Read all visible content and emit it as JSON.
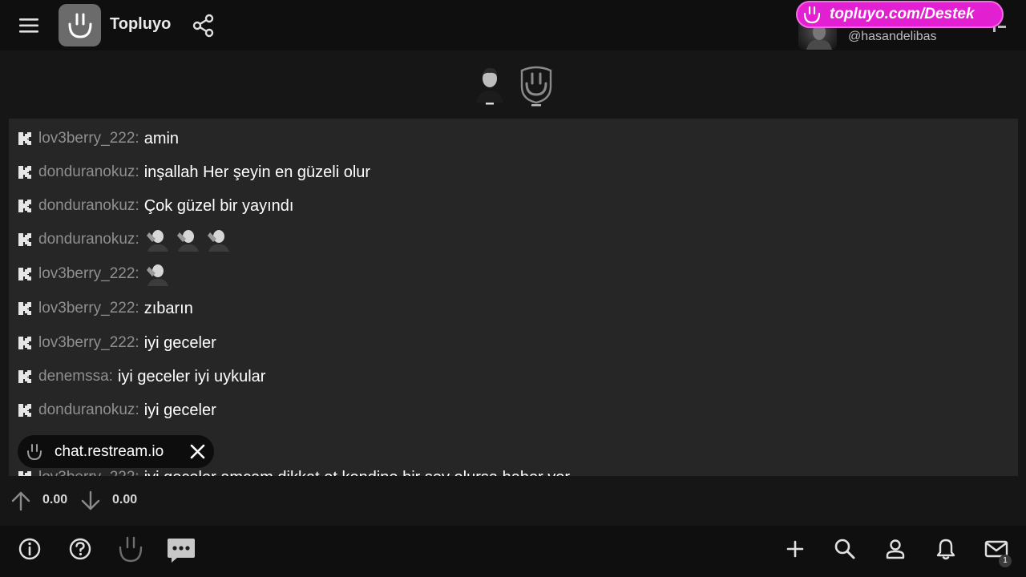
{
  "header": {
    "title": "Topluyo",
    "user_handle": "@hasandelibas"
  },
  "promo": {
    "text": "topluyo.com/Destek",
    "color": "#e21fd1"
  },
  "chat": {
    "messages": [
      {
        "user": "lov3berry_222",
        "text": "amin"
      },
      {
        "user": "donduranokuz",
        "text": "inşallah Her şeyin en güzeli olur"
      },
      {
        "user": "donduranokuz",
        "text": "Çok güzel bir yayındı"
      },
      {
        "user": "donduranokuz",
        "text": "",
        "emotes": 3
      },
      {
        "user": "lov3berry_222",
        "text": "",
        "emotes": 1
      },
      {
        "user": "lov3berry_222",
        "text": "zıbarın"
      },
      {
        "user": "lov3berry_222",
        "text": "iyi geceler"
      },
      {
        "user": "denemssa",
        "text": "iyi geceler iyi uykular"
      },
      {
        "user": "donduranokuz",
        "text": "iyi geceler"
      },
      {
        "user": "lov3berry_222",
        "text": "iyi geceler amcam dikkat et kendine bir şey olursa haber ver"
      }
    ]
  },
  "toast": {
    "text": "chat.restream.io"
  },
  "votes": {
    "up": "0.00",
    "down": "0.00"
  },
  "bottom_nav": {
    "mail_count": "1"
  },
  "icons": [
    "menu-icon",
    "share-icon",
    "close-icon",
    "arrow-up-icon",
    "arrow-down-icon",
    "info-icon",
    "help-icon",
    "chat-bubble-icon",
    "plus-icon",
    "search-icon",
    "user-icon",
    "bell-icon",
    "mail-icon"
  ]
}
